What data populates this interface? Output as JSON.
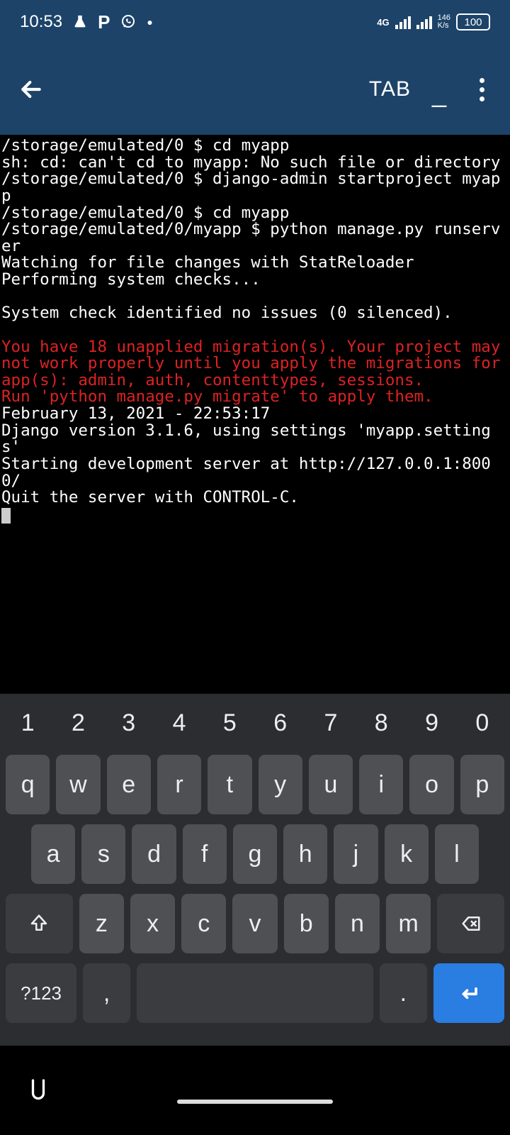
{
  "status": {
    "time": "10:53",
    "network_type": "4G",
    "net_speed": "146",
    "net_unit": "K/s",
    "battery": "100"
  },
  "appbar": {
    "tab_label": "TAB",
    "minimize_label": "_"
  },
  "terminal": {
    "lines": [
      {
        "t": "/storage/emulated/0 $ cd myapp",
        "c": "w"
      },
      {
        "t": "sh: cd: can't cd to myapp: No such file or directory",
        "c": "w"
      },
      {
        "t": "/storage/emulated/0 $ django-admin startproject myapp",
        "c": "w"
      },
      {
        "t": "/storage/emulated/0 $ cd myapp",
        "c": "w"
      },
      {
        "t": "/storage/emulated/0/myapp $ python manage.py runserver",
        "c": "w"
      },
      {
        "t": "Watching for file changes with StatReloader",
        "c": "w"
      },
      {
        "t": "Performing system checks...",
        "c": "w"
      },
      {
        "t": "",
        "c": "w"
      },
      {
        "t": "System check identified no issues (0 silenced).",
        "c": "w"
      },
      {
        "t": "",
        "c": "w"
      },
      {
        "t": "You have 18 unapplied migration(s). Your project may not work properly until you apply the migrations for app(s): admin, auth, contenttypes, sessions.",
        "c": "r"
      },
      {
        "t": "Run 'python manage.py migrate' to apply them.",
        "c": "r"
      },
      {
        "t": "February 13, 2021 - 22:53:17",
        "c": "w"
      },
      {
        "t": "Django version 3.1.6, using settings 'myapp.settings'",
        "c": "w"
      },
      {
        "t": "Starting development server at http://127.0.0.1:8000/",
        "c": "w"
      },
      {
        "t": "Quit the server with CONTROL-C.",
        "c": "w"
      }
    ]
  },
  "keyboard": {
    "row_num": [
      "1",
      "2",
      "3",
      "4",
      "5",
      "6",
      "7",
      "8",
      "9",
      "0"
    ],
    "row1": [
      "q",
      "w",
      "e",
      "r",
      "t",
      "y",
      "u",
      "i",
      "o",
      "p"
    ],
    "row2": [
      "a",
      "s",
      "d",
      "f",
      "g",
      "h",
      "j",
      "k",
      "l"
    ],
    "row3": [
      "z",
      "x",
      "c",
      "v",
      "b",
      "n",
      "m"
    ],
    "shift": "⇧",
    "backspace": "⌫",
    "symbols": "?123",
    "comma": ",",
    "period": ".",
    "enter": "↵"
  }
}
